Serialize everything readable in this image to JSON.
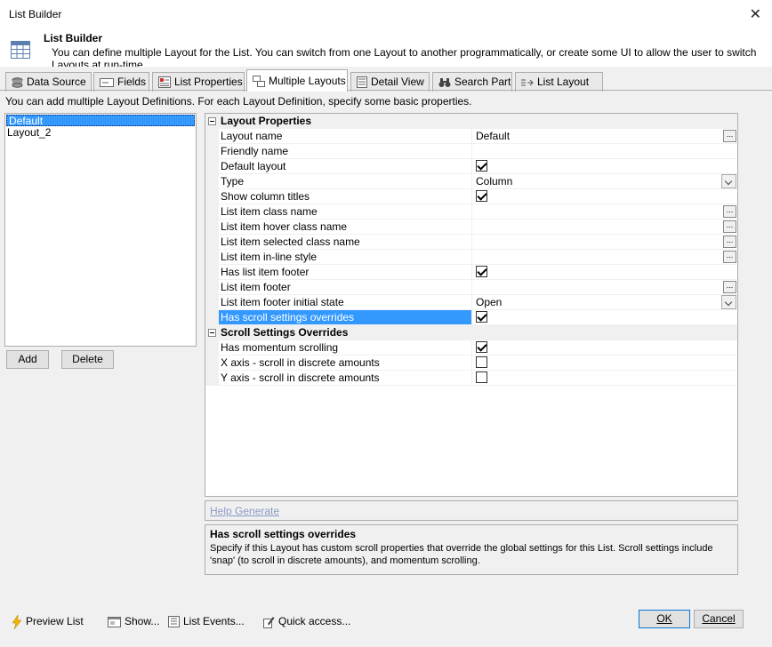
{
  "window": {
    "title": "List Builder",
    "close_glyph": "✕"
  },
  "header": {
    "title": "List Builder",
    "description": "You can define multiple Layout for the List. You can switch from one Layout to another programmatically, or create some UI to allow the user to switch Layouts at run-time."
  },
  "tabs": [
    {
      "label": "Data Source",
      "icon": "database-icon",
      "active": false
    },
    {
      "label": "Fields",
      "icon": "fields-icon",
      "active": false
    },
    {
      "label": "List Properties",
      "icon": "properties-icon",
      "active": false
    },
    {
      "label": "Multiple Layouts",
      "icon": "layouts-icon",
      "active": true
    },
    {
      "label": "Detail View",
      "icon": "detail-view-icon",
      "active": false
    },
    {
      "label": "Search Part",
      "icon": "binoculars-icon",
      "active": false
    },
    {
      "label": "List Layout",
      "icon": "list-layout-icon",
      "active": false
    }
  ],
  "info_text": "You can add multiple Layout Definitions. For each Layout Definition, specify some basic properties.",
  "layouts": {
    "items": [
      "Default",
      "Layout_2"
    ],
    "selected": "Default",
    "add_label": "Add",
    "delete_label": "Delete"
  },
  "properties": {
    "layout_category": "Layout Properties",
    "rows": [
      {
        "label": "Layout name",
        "value": "Default",
        "editor": "ellipsis"
      },
      {
        "label": "Friendly name",
        "value": "",
        "editor": "text"
      },
      {
        "label": "Default layout",
        "checked": true,
        "editor": "checkbox"
      },
      {
        "label": "Type",
        "value": "Column",
        "editor": "dropdown"
      },
      {
        "label": "Show column titles",
        "checked": true,
        "editor": "checkbox"
      },
      {
        "label": "List item class name",
        "value": "",
        "editor": "ellipsis"
      },
      {
        "label": "List item hover class name",
        "value": "",
        "editor": "ellipsis"
      },
      {
        "label": "List item selected class name",
        "value": "",
        "editor": "ellipsis"
      },
      {
        "label": "List item in-line style",
        "value": "",
        "editor": "ellipsis"
      },
      {
        "label": "Has list item footer",
        "checked": true,
        "editor": "checkbox"
      },
      {
        "label": "List item footer",
        "value": "",
        "editor": "ellipsis"
      },
      {
        "label": "List item footer initial state",
        "value": "Open",
        "editor": "dropdown"
      },
      {
        "label": "Has scroll settings overrides",
        "checked": true,
        "editor": "checkbox",
        "selected": true
      }
    ],
    "scroll_category": "Scroll Settings Overrides",
    "scroll_rows": [
      {
        "label": "Has momentum scrolling",
        "checked": true,
        "editor": "checkbox"
      },
      {
        "label": "X axis - scroll in discrete amounts",
        "checked": false,
        "editor": "checkbox"
      },
      {
        "label": "Y axis - scroll in discrete amounts",
        "checked": false,
        "editor": "checkbox"
      }
    ]
  },
  "help_link": "Help Generate",
  "description": {
    "title": "Has scroll settings overrides",
    "text": "Specify if this Layout has custom scroll properties that override the global settings for this List. Scroll settings include 'snap' (to scroll in discrete amounts), and momentum scrolling."
  },
  "footer": {
    "preview": "Preview List",
    "show": "Show...",
    "events": "List Events...",
    "quick": "Quick access...",
    "ok": "OK",
    "cancel": "Cancel"
  },
  "colors": {
    "selection": "#3399ff",
    "link": "#8a9bc4"
  }
}
